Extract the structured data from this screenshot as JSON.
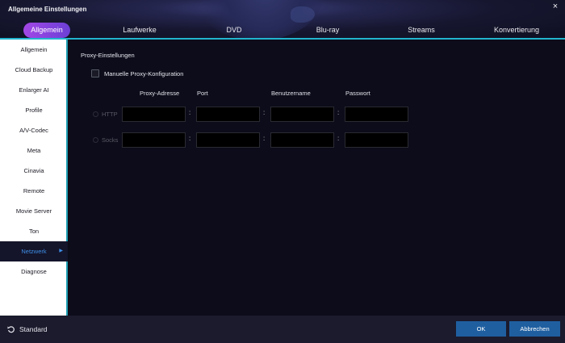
{
  "window": {
    "title": "Allgemeine Einstellungen",
    "close_glyph": "×"
  },
  "tabs": [
    {
      "label": "Allgemein",
      "active": true
    },
    {
      "label": "Laufwerke"
    },
    {
      "label": "DVD"
    },
    {
      "label": "Blu-ray"
    },
    {
      "label": "Streams"
    },
    {
      "label": "Konvertierung"
    }
  ],
  "sidebar": {
    "items": [
      {
        "label": "Allgemein"
      },
      {
        "label": "Cloud Backup"
      },
      {
        "label": "Enlarger AI"
      },
      {
        "label": "Profile"
      },
      {
        "label": "A/V-Codec"
      },
      {
        "label": "Meta"
      },
      {
        "label": "Cinavia"
      },
      {
        "label": "Remote"
      },
      {
        "label": "Movie Server"
      },
      {
        "label": "Ton"
      },
      {
        "label": "Netzwerk",
        "active": true,
        "arrow": "▶"
      },
      {
        "label": "Diagnose"
      }
    ]
  },
  "proxy": {
    "section_title": "Proxy-Einstellungen",
    "manual_label": "Manuelle Proxy-Konfiguration",
    "manual_checked": false,
    "columns": [
      "Proxy-Adresse",
      "Port",
      "Benutzername",
      "Passwort"
    ],
    "separator": ":",
    "rows": [
      {
        "label": "HTTP",
        "values": [
          "",
          "",
          "",
          ""
        ]
      },
      {
        "label": "Socks",
        "values": [
          "",
          "",
          "",
          ""
        ]
      }
    ]
  },
  "footer": {
    "standard_label": "Standard",
    "standard_icon": "reset-icon",
    "ok_label": "OK",
    "cancel_label": "Abbrechen"
  },
  "colors": {
    "accent_teal": "#22b5cf",
    "tab_active": "#a347e6",
    "sidebar_active_text": "#3e8fe6",
    "button": "#1f5fa0"
  }
}
